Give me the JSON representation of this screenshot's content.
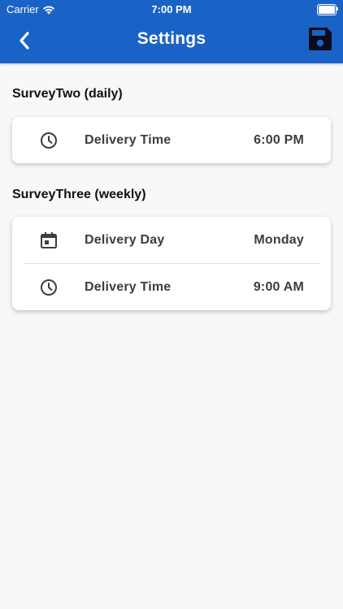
{
  "status_bar": {
    "carrier": "Carrier",
    "time": "7:00 PM"
  },
  "header": {
    "title": "Settings",
    "back_icon": "chevron-left-icon",
    "save_icon": "floppy-disk-icon",
    "background_color": "#1a63c6"
  },
  "sections": [
    {
      "title": "SurveyTwo (daily)",
      "rows": [
        {
          "icon": "clock-icon",
          "label": "Delivery Time",
          "value": "6:00 PM"
        }
      ]
    },
    {
      "title": "SurveyThree (weekly)",
      "rows": [
        {
          "icon": "calendar-icon",
          "label": "Delivery Day",
          "value": "Monday"
        },
        {
          "icon": "clock-icon",
          "label": "Delivery Time",
          "value": "9:00 AM"
        }
      ]
    }
  ]
}
